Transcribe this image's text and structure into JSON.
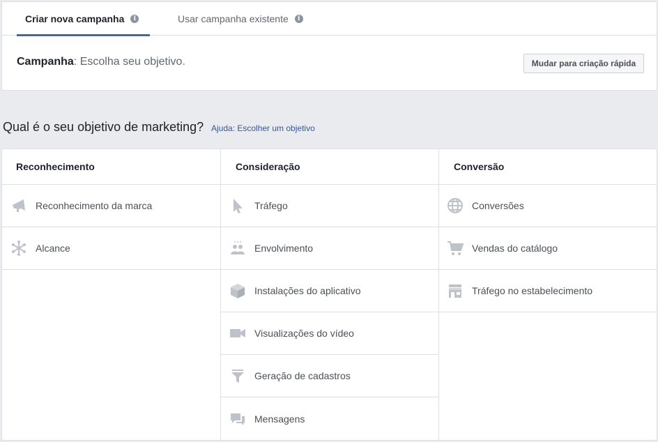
{
  "tabs": {
    "create_new": "Criar nova campanha",
    "use_existing": "Usar campanha existente",
    "info_glyph": "i"
  },
  "campaign": {
    "label": "Campanha",
    "separator": ":",
    "text": " Escolha seu objetivo."
  },
  "quick_button": "Mudar para criação rápida",
  "question": "Qual é o seu objetivo de marketing?",
  "help_link": "Ajuda: Escolher um objetivo",
  "columns": {
    "awareness": {
      "title": "Reconhecimento",
      "items": [
        {
          "label": "Reconhecimento da marca",
          "icon": "megaphone-icon"
        },
        {
          "label": "Alcance",
          "icon": "reach-icon"
        }
      ]
    },
    "consideration": {
      "title": "Consideração",
      "items": [
        {
          "label": "Tráfego",
          "icon": "cursor-icon"
        },
        {
          "label": "Envolvimento",
          "icon": "people-icon"
        },
        {
          "label": "Instalações do aplicativo",
          "icon": "box-icon"
        },
        {
          "label": "Visualizações do vídeo",
          "icon": "video-camera-icon"
        },
        {
          "label": "Geração de cadastros",
          "icon": "funnel-icon"
        },
        {
          "label": "Mensagens",
          "icon": "chat-bubbles-icon"
        }
      ]
    },
    "conversion": {
      "title": "Conversão",
      "items": [
        {
          "label": "Conversões",
          "icon": "globe-icon"
        },
        {
          "label": "Vendas do catálogo",
          "icon": "cart-icon"
        },
        {
          "label": "Tráfego no estabelecimento",
          "icon": "store-icon"
        }
      ]
    }
  },
  "colors": {
    "accent": "#4267b2",
    "link": "#365899",
    "icon": "#bec3c9",
    "background": "#e9ebee"
  }
}
